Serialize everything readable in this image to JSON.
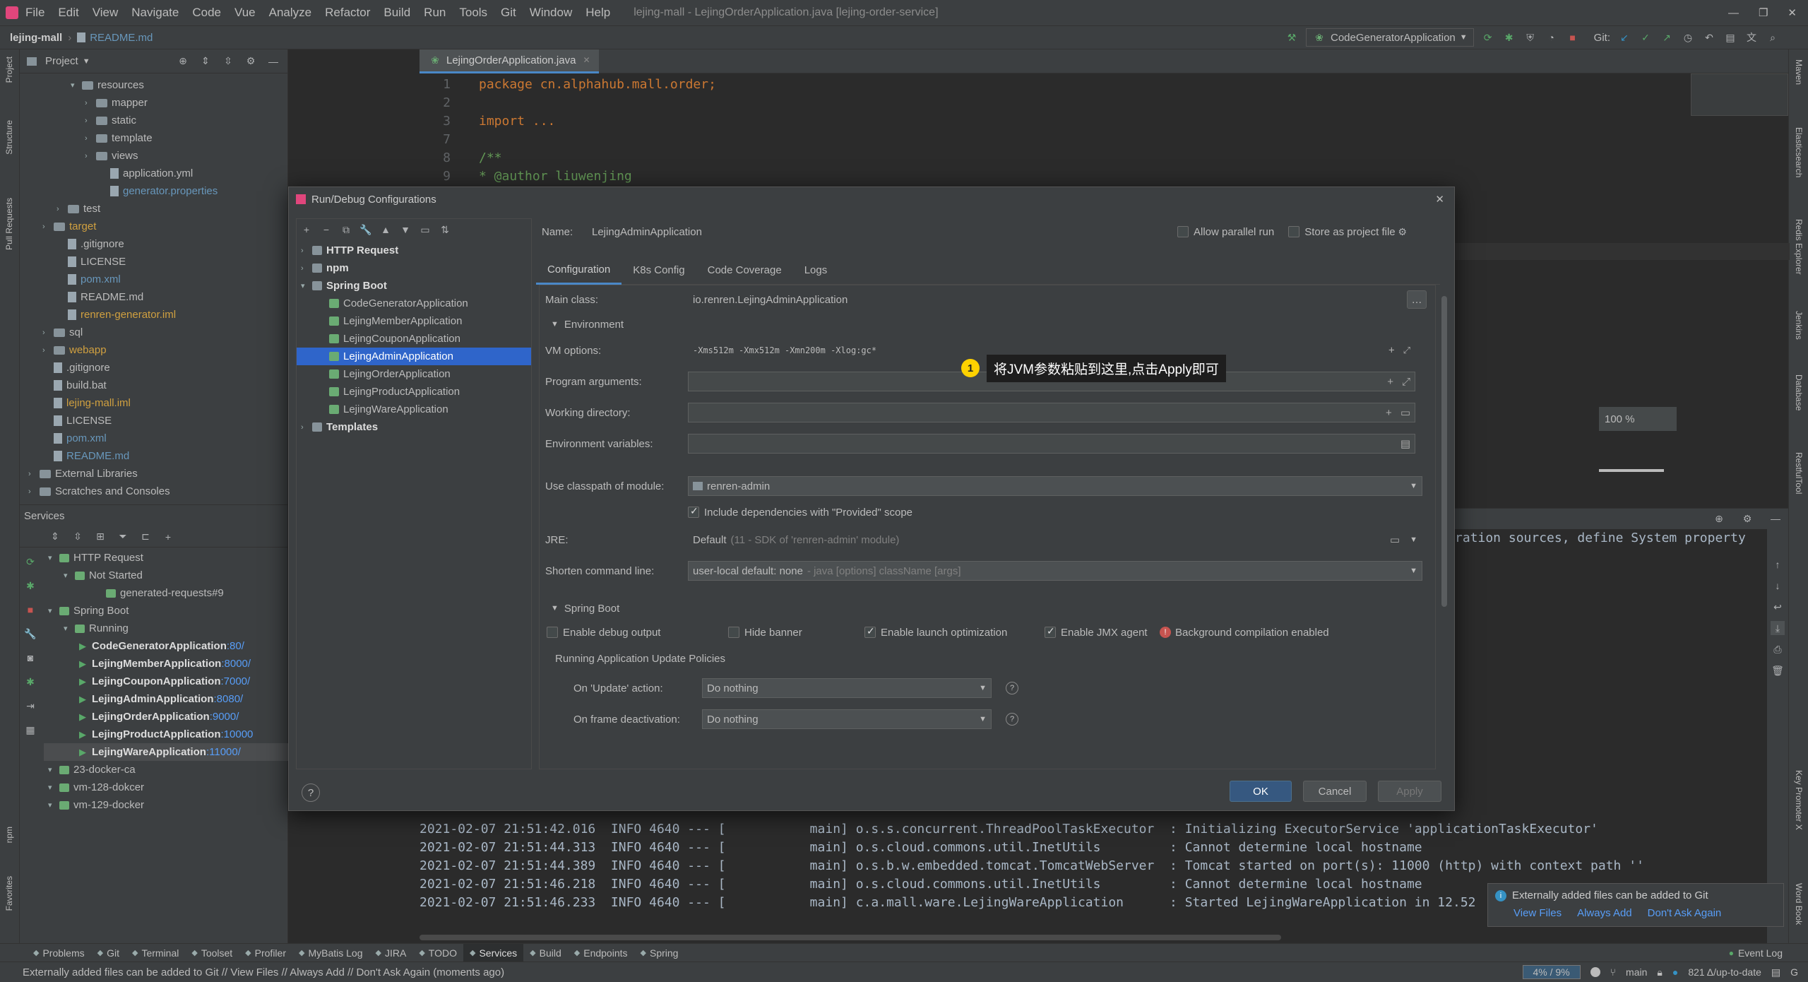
{
  "menu": [
    "File",
    "Edit",
    "View",
    "Navigate",
    "Code",
    "Vue",
    "Analyze",
    "Refactor",
    "Build",
    "Run",
    "Tools",
    "Git",
    "Window",
    "Help"
  ],
  "window_title": "lejing-mall - LejingOrderApplication.java [lejing-order-service]",
  "breadcrumb": {
    "project": "lejing-mall",
    "file": "README.md"
  },
  "run_config": "CodeGeneratorApplication",
  "git_label": "Git:",
  "left_strip": [
    "Project",
    "Structure",
    "Pull Requests",
    "npm",
    "Favorites"
  ],
  "right_strip": [
    "Maven",
    "Elasticsearch",
    "Redis Explorer",
    "Jenkins",
    "Database",
    "RestfulTool",
    "Key Promoter X",
    "Word Book"
  ],
  "project_panel": {
    "title": "Project",
    "items": [
      {
        "label": "resources",
        "indent": 3,
        "type": "folder",
        "open": true
      },
      {
        "label": "mapper",
        "indent": 4,
        "type": "folder"
      },
      {
        "label": "static",
        "indent": 4,
        "type": "folder"
      },
      {
        "label": "template",
        "indent": 4,
        "type": "folder"
      },
      {
        "label": "views",
        "indent": 4,
        "type": "folder"
      },
      {
        "label": "application.yml",
        "indent": 5,
        "type": "file"
      },
      {
        "label": "generator.properties",
        "indent": 5,
        "type": "file",
        "color": "#6897bb"
      },
      {
        "label": "test",
        "indent": 2,
        "type": "folder"
      },
      {
        "label": "target",
        "indent": 1,
        "type": "folder",
        "color": "#d0a040"
      },
      {
        "label": ".gitignore",
        "indent": 2,
        "type": "file"
      },
      {
        "label": "LICENSE",
        "indent": 2,
        "type": "file"
      },
      {
        "label": "pom.xml",
        "indent": 2,
        "type": "file",
        "color": "#6897bb"
      },
      {
        "label": "README.md",
        "indent": 2,
        "type": "file"
      },
      {
        "label": "renren-generator.iml",
        "indent": 2,
        "type": "file",
        "color": "#d0a040"
      },
      {
        "label": "sql",
        "indent": 1,
        "type": "folder"
      },
      {
        "label": "webapp",
        "indent": 1,
        "type": "folder",
        "color": "#d0a040"
      },
      {
        "label": ".gitignore",
        "indent": 1,
        "type": "file"
      },
      {
        "label": "build.bat",
        "indent": 1,
        "type": "file"
      },
      {
        "label": "lejing-mall.iml",
        "indent": 1,
        "type": "file",
        "color": "#d0a040"
      },
      {
        "label": "LICENSE",
        "indent": 1,
        "type": "file"
      },
      {
        "label": "pom.xml",
        "indent": 1,
        "type": "file",
        "color": "#6897bb"
      },
      {
        "label": "README.md",
        "indent": 1,
        "type": "file",
        "color": "#6897bb"
      },
      {
        "label": "External Libraries",
        "indent": 0,
        "type": "folder"
      },
      {
        "label": "Scratches and Consoles",
        "indent": 0,
        "type": "folder"
      }
    ]
  },
  "services": {
    "title": "Services",
    "items": [
      {
        "label": "HTTP Request",
        "indent": 0
      },
      {
        "label": "Not Started",
        "indent": 1
      },
      {
        "label": "generated-requests#9",
        "indent": 3
      },
      {
        "label": "Spring Boot",
        "indent": 0
      },
      {
        "label": "Running",
        "indent": 1
      },
      {
        "label": "CodeGeneratorApplication",
        "port": ":80/",
        "indent": 2
      },
      {
        "label": "LejingMemberApplication",
        "port": ":8000/",
        "indent": 2
      },
      {
        "label": "LejingCouponApplication",
        "port": ":7000/",
        "indent": 2
      },
      {
        "label": "LejingAdminApplication",
        "port": ":8080/",
        "indent": 2
      },
      {
        "label": "LejingOrderApplication",
        "port": ":9000/",
        "indent": 2
      },
      {
        "label": "LejingProductApplication",
        "port": ":10000",
        "indent": 2
      },
      {
        "label": "LejingWareApplication",
        "port": ":11000/",
        "indent": 2
      },
      {
        "label": "23-docker-ca",
        "indent": 0
      },
      {
        "label": "vm-128-dokcer",
        "indent": 0
      },
      {
        "label": "vm-129-docker",
        "indent": 0
      }
    ]
  },
  "editor": {
    "tab": "LejingOrderApplication.java",
    "lines": [
      {
        "n": "1",
        "code": "package cn.alphahub.mall.order;"
      },
      {
        "n": "2",
        "code": ""
      },
      {
        "n": "3",
        "code": "import ..."
      },
      {
        "n": "7",
        "code": ""
      },
      {
        "n": "8",
        "code": "/**"
      },
      {
        "n": "9",
        "code": " * @author liuwenjing"
      }
    ]
  },
  "zoom_label": "100 %",
  "console": {
    "partial_lines": [
      "ration sources, define System property a"
    ],
    "lines": [
      "2021-02-07 21:51:42.016  INFO 4640 --- [           main] o.s.s.concurrent.ThreadPoolTaskExecutor  : Initializing ExecutorService 'applicationTaskExecutor'",
      "2021-02-07 21:51:44.313  INFO 4640 --- [           main] o.s.cloud.commons.util.InetUtils         : Cannot determine local hostname",
      "2021-02-07 21:51:44.389  INFO 4640 --- [           main] o.s.b.w.embedded.tomcat.TomcatWebServer  : Tomcat started on port(s): 11000 (http) with context path ''",
      "2021-02-07 21:51:46.218  INFO 4640 --- [           main] o.s.cloud.commons.util.InetUtils         : Cannot determine local hostname",
      "2021-02-07 21:51:46.233  INFO 4640 --- [           main] c.a.mall.ware.LejingWareApplication      : Started LejingWareApplication in 12.52"
    ]
  },
  "dialog": {
    "title": "Run/Debug Configurations",
    "tree": [
      {
        "label": "HTTP Request",
        "indent": 0,
        "bold": true
      },
      {
        "label": "npm",
        "indent": 0,
        "bold": true
      },
      {
        "label": "Spring Boot",
        "indent": 0,
        "bold": true
      },
      {
        "label": "CodeGeneratorApplication",
        "indent": 1
      },
      {
        "label": "LejingMemberApplication",
        "indent": 1
      },
      {
        "label": "LejingCouponApplication",
        "indent": 1
      },
      {
        "label": "LejingAdminApplication",
        "indent": 1,
        "selected": true
      },
      {
        "label": "LejingOrderApplication",
        "indent": 1
      },
      {
        "label": "LejingProductApplication",
        "indent": 1
      },
      {
        "label": "LejingWareApplication",
        "indent": 1
      },
      {
        "label": "Templates",
        "indent": 0,
        "bold": true
      }
    ],
    "name_label": "Name:",
    "name_value": "LejingAdminApplication",
    "allow_parallel": "Allow parallel run",
    "store_as_project": "Store as project file",
    "tabs": [
      "Configuration",
      "K8s Config",
      "Code Coverage",
      "Logs"
    ],
    "main_class_label": "Main class:",
    "main_class": "io.renren.LejingAdminApplication",
    "environment": "Environment",
    "vm_options_label": "VM options:",
    "vm_options": "-Xms512m -Xmx512m -Xmn200m -Xlog:gc*",
    "callout_num": "1",
    "callout": "将JVM参数粘贴到这里,点击Apply即可",
    "program_args_label": "Program arguments:",
    "working_dir_label": "Working directory:",
    "env_vars_label": "Environment variables:",
    "classpath_label": "Use classpath of module:",
    "classpath": "renren-admin",
    "include_deps": "Include dependencies with \"Provided\" scope",
    "jre_label": "JRE:",
    "jre": "Default",
    "jre_hint": "(11 - SDK of 'renren-admin' module)",
    "shorten_label": "Shorten command line:",
    "shorten": "user-local default: none",
    "shorten_hint": "- java [options] className [args]",
    "spring_boot": "Spring Boot",
    "debug_output": "Enable debug output",
    "hide_banner": "Hide banner",
    "launch_opt": "Enable launch optimization",
    "jmx": "Enable JMX agent",
    "bg_compile": "Background compilation enabled",
    "update_policies": "Running Application Update Policies",
    "on_update_label": "On 'Update' action:",
    "on_update": "Do nothing",
    "on_frame_label": "On frame deactivation:",
    "on_frame": "Do nothing",
    "ok": "OK",
    "cancel": "Cancel",
    "apply": "Apply",
    "help": "?"
  },
  "notification": {
    "text": "Externally added files can be added to Git",
    "actions": [
      "View Files",
      "Always Add",
      "Don't Ask Again"
    ]
  },
  "tool_tabs": [
    "Problems",
    "Git",
    "Terminal",
    "Toolset",
    "Profiler",
    "MyBatis Log",
    "JIRA",
    "TODO",
    "Services",
    "Build",
    "Endpoints",
    "Spring"
  ],
  "event_log": "Event Log",
  "status": {
    "message": "Externally added files can be added to Git // View Files // Always Add // Don't Ask Again (moments ago)",
    "memory": "4% / 9%",
    "branch": "main",
    "git_status": "821 Δ/up-to-date",
    "encoding": "G"
  }
}
